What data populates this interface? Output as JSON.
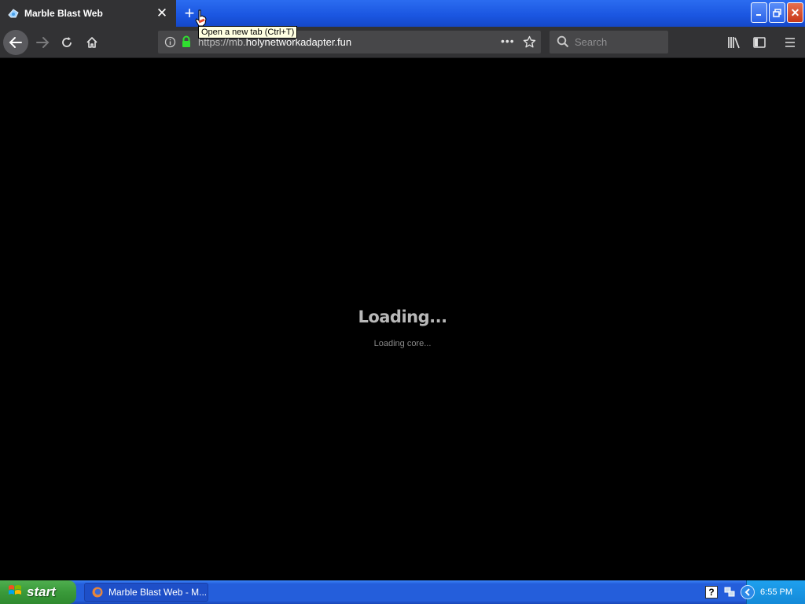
{
  "browser": {
    "tab": {
      "title": "Marble Blast Web",
      "favicon": "marble-blast-icon"
    },
    "new_tab_tooltip": "Open a new tab (Ctrl+T)",
    "url": {
      "prefix": "https://mb.",
      "domain": "holynetworkadapter.fun"
    },
    "search": {
      "placeholder": "Search"
    }
  },
  "page": {
    "loading_title": "Loading...",
    "loading_status": "Loading core..."
  },
  "taskbar": {
    "start_label": "start",
    "window_item": "Marble Blast Web - M...",
    "clock": "6:55 PM"
  },
  "colors": {
    "tab_active": "#323234",
    "titlebar": "#1a55e0",
    "taskbar": "#245edb",
    "start_green": "#3a9a3a",
    "page_background": "#000000"
  }
}
